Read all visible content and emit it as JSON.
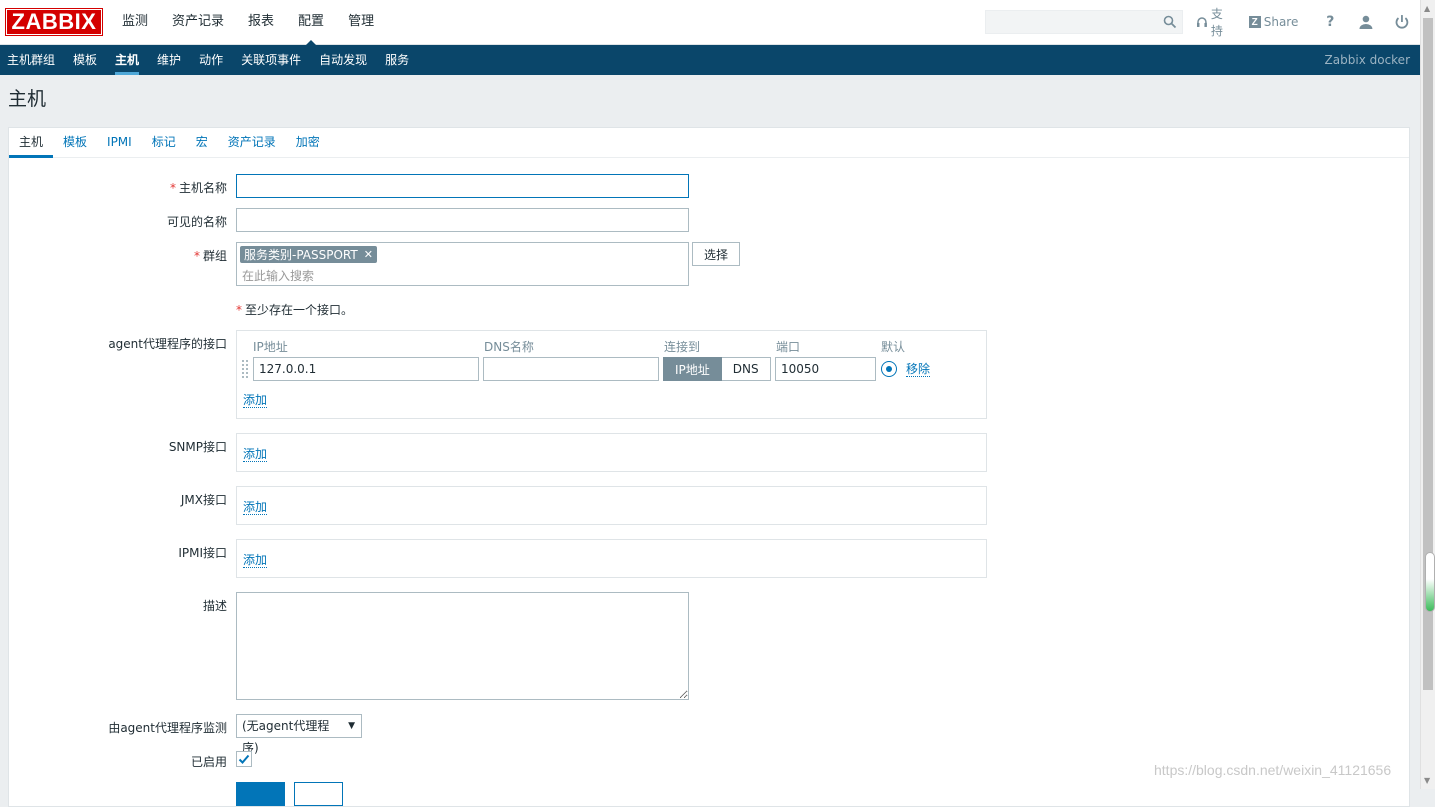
{
  "logo": "ZABBIX",
  "main_nav": [
    "监测",
    "资产记录",
    "报表",
    "配置",
    "管理"
  ],
  "search": {
    "placeholder": ""
  },
  "top_links": {
    "support": "支持",
    "share": "Share",
    "help": "?"
  },
  "sub_nav": [
    "主机群组",
    "模板",
    "主机",
    "维护",
    "动作",
    "关联项事件",
    "自动发现",
    "服务"
  ],
  "server_name": "Zabbix docker",
  "page_title": "主机",
  "tabs": [
    "主机",
    "模板",
    "IPMI",
    "标记",
    "宏",
    "资产记录",
    "加密"
  ],
  "form": {
    "host_name_label": "主机名称",
    "host_name_value": "",
    "visible_name_label": "可见的名称",
    "visible_name_value": "",
    "groups_label": "群组",
    "group_chip": "服务类别-PASSPORT",
    "groups_placeholder": "在此输入搜索",
    "select_button": "选择",
    "interface_note": "至少存在一个接口。",
    "required_mark": "*",
    "agent_label": "agent代理程序的接口",
    "columns": {
      "ip": "IP地址",
      "dns": "DNS名称",
      "connect": "连接到",
      "port": "端口",
      "default": "默认"
    },
    "agent_row": {
      "ip": "127.0.0.1",
      "dns": "",
      "connect_ip": "IP地址",
      "connect_dns": "DNS",
      "port": "10050",
      "remove": "移除"
    },
    "add_label": "添加",
    "snmp_label": "SNMP接口",
    "jmx_label": "JMX接口",
    "ipmi_label": "IPMI接口",
    "description_label": "描述",
    "proxy_label": "由agent代理程序监测",
    "proxy_value": "(无agent代理程序)",
    "enabled_label": "已启用"
  },
  "watermark": "https://blog.csdn.net/weixin_41121656",
  "colors": {
    "brand": "#d40000",
    "nav": "#0a466a",
    "accent": "#0275b8"
  }
}
